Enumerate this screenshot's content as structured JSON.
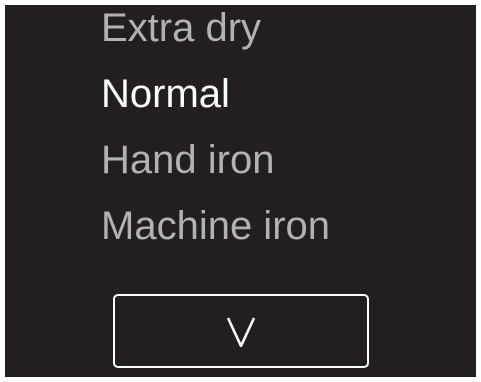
{
  "menu": {
    "options": [
      {
        "label": "Extra dry",
        "selected": false
      },
      {
        "label": "Normal",
        "selected": true
      },
      {
        "label": "Hand iron",
        "selected": false
      },
      {
        "label": "Machine iron",
        "selected": false
      }
    ],
    "scroll_button_icon": "chevron-down-icon"
  },
  "colors": {
    "background": "#231f20",
    "selected_text": "#ffffff",
    "unselected_text": "#b3b1b1",
    "button_border": "#ffffff"
  }
}
